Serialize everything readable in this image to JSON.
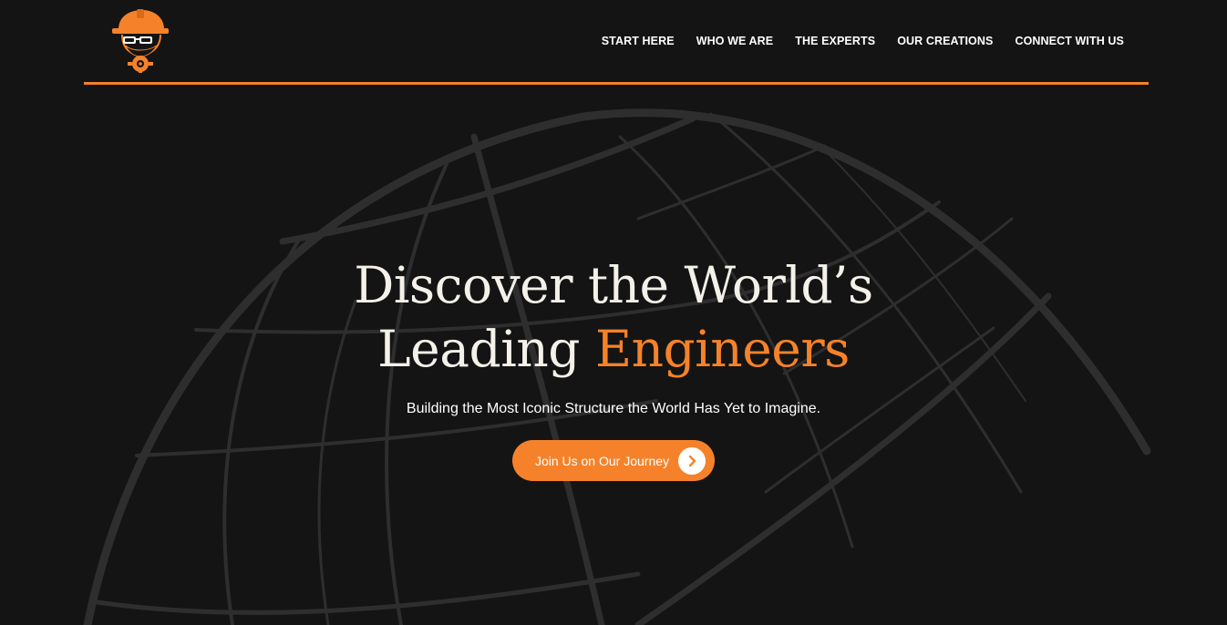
{
  "brand": {
    "logo_icon": "engineer-hardhat-logo-icon",
    "accent_color": "#f5822a",
    "background_color": "#141414"
  },
  "nav": {
    "items": [
      {
        "label": "START HERE"
      },
      {
        "label": "WHO WE ARE"
      },
      {
        "label": "THE EXPERTS"
      },
      {
        "label": "OUR CREATIONS"
      },
      {
        "label": "CONNECT WITH US"
      }
    ]
  },
  "hero": {
    "title_line1": "Discover the World’s",
    "title_line2_plain": "Leading ",
    "title_line2_accent": "Engineers",
    "subtitle": "Building the Most Iconic Structure the World Has Yet to Imagine.",
    "cta_label": "Join Us on Our Journey",
    "cta_icon": "chevron-right-icon",
    "background_graphic": "globe-grid-icon"
  }
}
